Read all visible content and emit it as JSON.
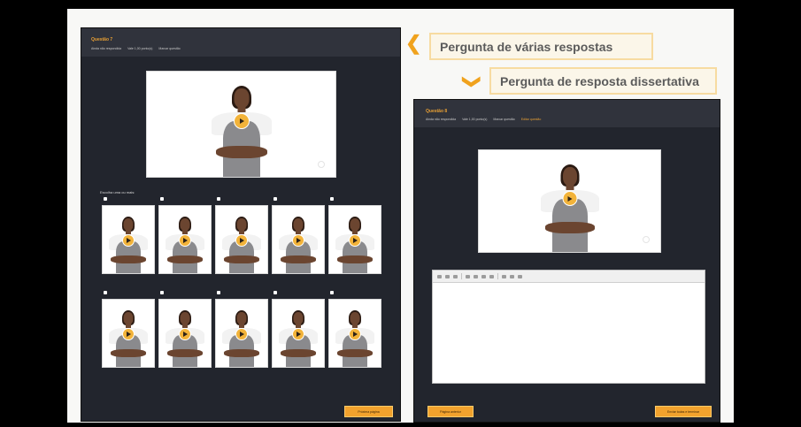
{
  "callouts": {
    "multiple": "Pergunta de várias respostas",
    "essay": "Pergunta de resposta dissertativa"
  },
  "left_panel": {
    "question_title": "Questão 7",
    "meta": [
      "Ainda não respondida",
      "Vale 1,00 ponto(s)",
      "Marcar questão"
    ],
    "choose_label": "Escolha uma ou mais:",
    "next_button": "Próxima página",
    "option_count": 10
  },
  "right_panel": {
    "question_title": "Questão 8",
    "meta": [
      "Ainda não respondida",
      "Vale 1,00 ponto(s)",
      "Marcar questão",
      "Editar questão"
    ],
    "prev_button": "Página anterior",
    "finish_button": "Enviar todas e terminar"
  },
  "colors": {
    "accent": "#f2a22d",
    "panel_bg": "#22252d",
    "callout_border": "#f7dba1"
  },
  "icons": {
    "play": "play-icon",
    "callout_arrow_left": "chevron-left-icon",
    "callout_arrow_down": "chevron-down-icon"
  }
}
